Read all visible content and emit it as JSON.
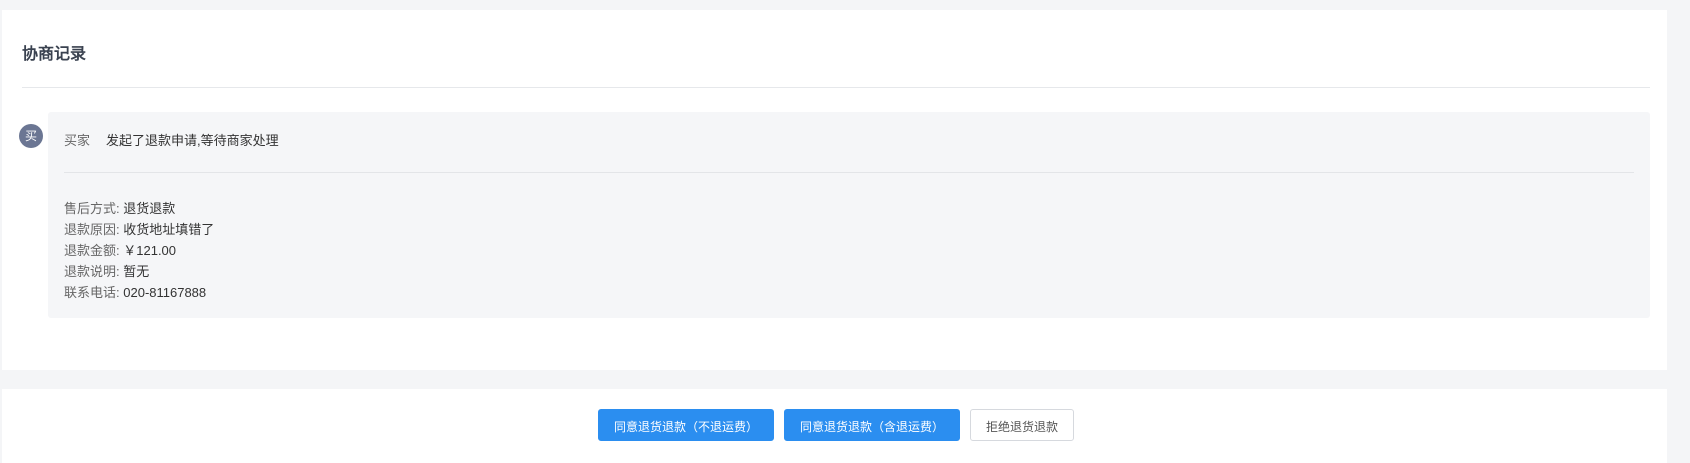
{
  "section": {
    "title": "协商记录"
  },
  "record": {
    "avatar_text": "买",
    "actor": "买家",
    "action": "发起了退款申请,等待商家处理",
    "details": [
      {
        "label": "售后方式:",
        "value": "退货退款"
      },
      {
        "label": "退款原因:",
        "value": "收货地址填错了"
      },
      {
        "label": "退款金额:",
        "value": "￥121.00"
      },
      {
        "label": "退款说明:",
        "value": "暂无"
      },
      {
        "label": "联系电话:",
        "value": "020-81167888"
      }
    ]
  },
  "actions": {
    "agree_no_shipping": "同意退货退款（不退运费）",
    "agree_with_shipping": "同意退货退款（含退运费）",
    "reject": "拒绝退货退款"
  },
  "colors": {
    "primary": "#2b8ef0",
    "avatar": "#6b7693"
  }
}
